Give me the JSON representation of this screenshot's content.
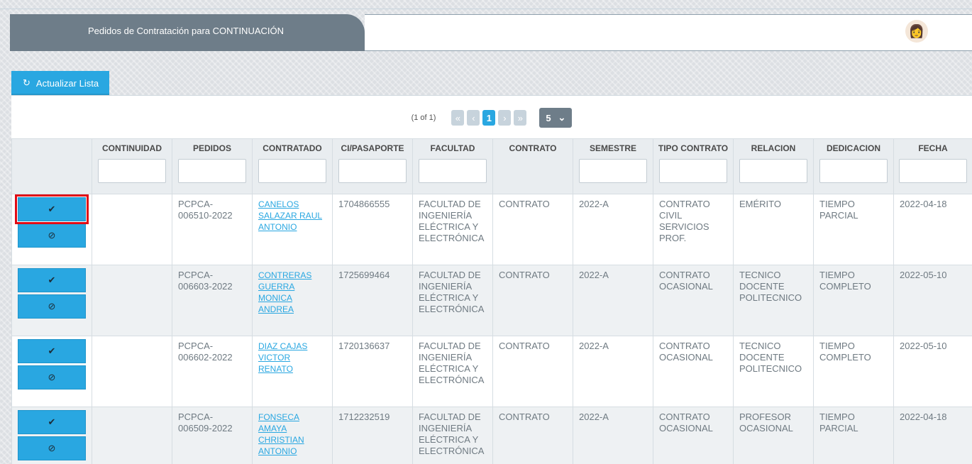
{
  "header": {
    "title": "Pedidos de Contratación para CONTINUACIÓN",
    "avatar": "avatar-icon"
  },
  "toolbar": {
    "refresh_label": "Actualizar Lista",
    "refresh_icon": "↻"
  },
  "pager": {
    "info": "(1 of 1)",
    "first": "«",
    "prev": "‹",
    "page": "1",
    "next": "›",
    "last": "»",
    "rows": "5",
    "rows_arrow": "⌄"
  },
  "columns": [
    "",
    "CONTINUIDAD",
    "PEDIDOS",
    "CONTRATADO",
    "CI/PASAPORTE",
    "FACULTAD",
    "CONTRATO",
    "SEMESTRE",
    "TIPO CONTRATO",
    "RELACION",
    "DEDICACION",
    "FECHA"
  ],
  "actions": {
    "approve": "✔",
    "reject": "⊘"
  },
  "rows": [
    {
      "continuidad": "",
      "pedido": "PCPCA-006510-2022",
      "contratado": "CANELOS SALAZAR RAUL ANTONIO",
      "ci": "1704866555",
      "facultad": "FACULTAD DE INGENIERÍA ELÉCTRICA Y ELECTRÓNICA",
      "contrato": "CONTRATO",
      "semestre": "2022-A",
      "tipo": "CONTRATO CIVIL SERVICIOS PROF.",
      "relacion": "EMÉRITO",
      "dedicacion": "TIEMPO PARCIAL",
      "fecha": "2022-04-18"
    },
    {
      "continuidad": "",
      "pedido": "PCPCA-006603-2022",
      "contratado": "CONTRERAS GUERRA MONICA ANDREA",
      "ci": "1725699464",
      "facultad": "FACULTAD DE INGENIERÍA ELÉCTRICA Y ELECTRÓNICA",
      "contrato": "CONTRATO",
      "semestre": "2022-A",
      "tipo": "CONTRATO OCASIONAL",
      "relacion": "TECNICO DOCENTE POLITECNICO",
      "dedicacion": "TIEMPO COMPLETO",
      "fecha": "2022-05-10"
    },
    {
      "continuidad": "",
      "pedido": "PCPCA-006602-2022",
      "contratado": "DIAZ CAJAS VICTOR RENATO",
      "ci": "1720136637",
      "facultad": "FACULTAD DE INGENIERÍA ELÉCTRICA Y ELECTRÓNICA",
      "contrato": "CONTRATO",
      "semestre": "2022-A",
      "tipo": "CONTRATO OCASIONAL",
      "relacion": "TECNICO DOCENTE POLITECNICO",
      "dedicacion": "TIEMPO COMPLETO",
      "fecha": "2022-05-10"
    },
    {
      "continuidad": "",
      "pedido": "PCPCA-006509-2022",
      "contratado": "FONSECA AMAYA CHRISTIAN ANTONIO",
      "ci": "1712232519",
      "facultad": "FACULTAD DE INGENIERÍA ELÉCTRICA Y ELECTRÓNICA",
      "contrato": "CONTRATO",
      "semestre": "2022-A",
      "tipo": "CONTRATO OCASIONAL",
      "relacion": "PROFESOR OCASIONAL",
      "dedicacion": "TIEMPO PARCIAL",
      "fecha": "2022-04-18"
    }
  ]
}
